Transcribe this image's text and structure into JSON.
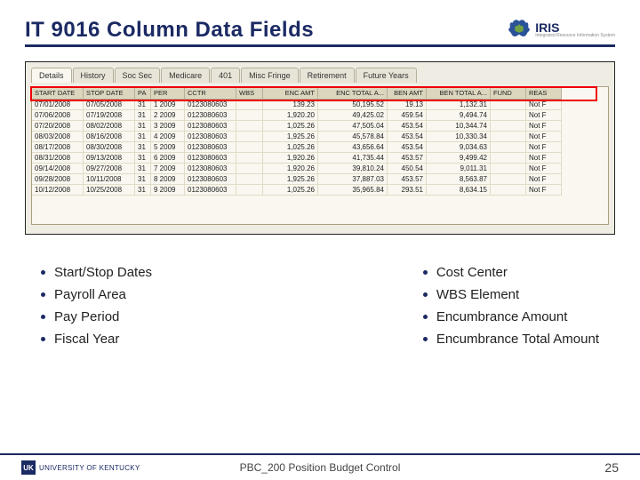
{
  "header": {
    "title": "IT 9016 Column Data Fields",
    "logo_name": "IRIS",
    "logo_tag": "Integrated Resource Information System"
  },
  "screenshot": {
    "tabs": [
      "Details",
      "History",
      "Soc Sec",
      "Medicare",
      "401",
      "Misc Fringe",
      "Retirement",
      "Future Years"
    ],
    "columns": [
      "START DATE",
      "STOP DATE",
      "PA",
      "PER",
      "CCTR",
      "WBS",
      "ENC AMT",
      "ENC TOTAL A...",
      "BEN AMT",
      "BEN TOTAL A...",
      "FUND",
      "REAS"
    ],
    "rows": [
      [
        "07/01/2008",
        "07/05/2008",
        "31",
        "1 2009",
        "0123080603",
        "",
        "139.23",
        "50,195.52",
        "19.13",
        "1,132.31",
        "",
        "Not F"
      ],
      [
        "07/06/2008",
        "07/19/2008",
        "31",
        "2 2009",
        "0123080603",
        "",
        "1,920.20",
        "49,425.02",
        "459.54",
        "9,494.74",
        "",
        "Not F"
      ],
      [
        "07/20/2008",
        "08/02/2008",
        "31",
        "3 2009",
        "0123080603",
        "",
        "1,025.26",
        "47,505.04",
        "453.54",
        "10,344.74",
        "",
        "Not F"
      ],
      [
        "08/03/2008",
        "08/16/2008",
        "31",
        "4 2009",
        "0123080603",
        "",
        "1,925.26",
        "45,578.84",
        "453.54",
        "10,330.34",
        "",
        "Not F"
      ],
      [
        "08/17/2008",
        "08/30/2008",
        "31",
        "5 2009",
        "0123080603",
        "",
        "1,025.26",
        "43,656.64",
        "453.54",
        "9,034.63",
        "",
        "Not F"
      ],
      [
        "08/31/2008",
        "09/13/2008",
        "31",
        "6 2009",
        "0123080603",
        "",
        "1,920.26",
        "41,735.44",
        "453.57",
        "9,499.42",
        "",
        "Not F"
      ],
      [
        "09/14/2008",
        "09/27/2008",
        "31",
        "7 2009",
        "0123080603",
        "",
        "1,920.26",
        "39,810.24",
        "450.54",
        "9,011.31",
        "",
        "Not F"
      ],
      [
        "09/28/2008",
        "10/11/2008",
        "31",
        "8 2009",
        "0123080603",
        "",
        "1,925.26",
        "37,887.03",
        "453.57",
        "8,563.87",
        "",
        "Not F"
      ],
      [
        "10/12/2008",
        "10/25/2008",
        "31",
        "9 2009",
        "0123080603",
        "",
        "1,025.26",
        "35,965.84",
        "293.51",
        "8,634.15",
        "",
        "Not F"
      ]
    ]
  },
  "bullets_left": [
    "Start/Stop Dates",
    "Payroll Area",
    "Pay Period",
    "Fiscal Year"
  ],
  "bullets_right": [
    "Cost Center",
    "WBS Element",
    "Encumbrance Amount",
    "Encumbrance Total Amount"
  ],
  "footer": {
    "uk_mark": "UK",
    "uk_text": "UNIVERSITY OF KENTUCKY",
    "center": "PBC_200 Position Budget Control",
    "page": "25"
  }
}
